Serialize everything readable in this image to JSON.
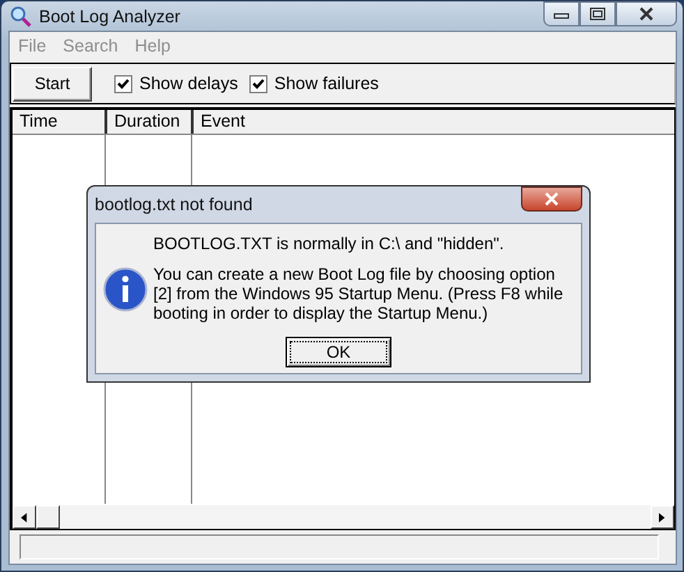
{
  "window": {
    "title": "Boot Log Analyzer"
  },
  "menu": [
    {
      "label": "File"
    },
    {
      "label": "Search"
    },
    {
      "label": "Help"
    }
  ],
  "toolbar": {
    "button": {
      "label": "Start"
    },
    "checkboxes": [
      {
        "label": "Show delays",
        "checked": true
      },
      {
        "label": "Show failures",
        "checked": true
      }
    ]
  },
  "table": {
    "columns": [
      "Time",
      "Duration",
      "Event"
    ]
  },
  "dialog": {
    "title": "bootlog.txt not found",
    "paragraphs": [
      "BOOTLOG.TXT is normally in C:\\ and \"hidden\".",
      "You can create a new Boot Log file by choosing option [2] from the Windows 95 Startup Menu. (Press F8 while booting in order to display the Startup Menu.)"
    ],
    "button": "OK"
  }
}
